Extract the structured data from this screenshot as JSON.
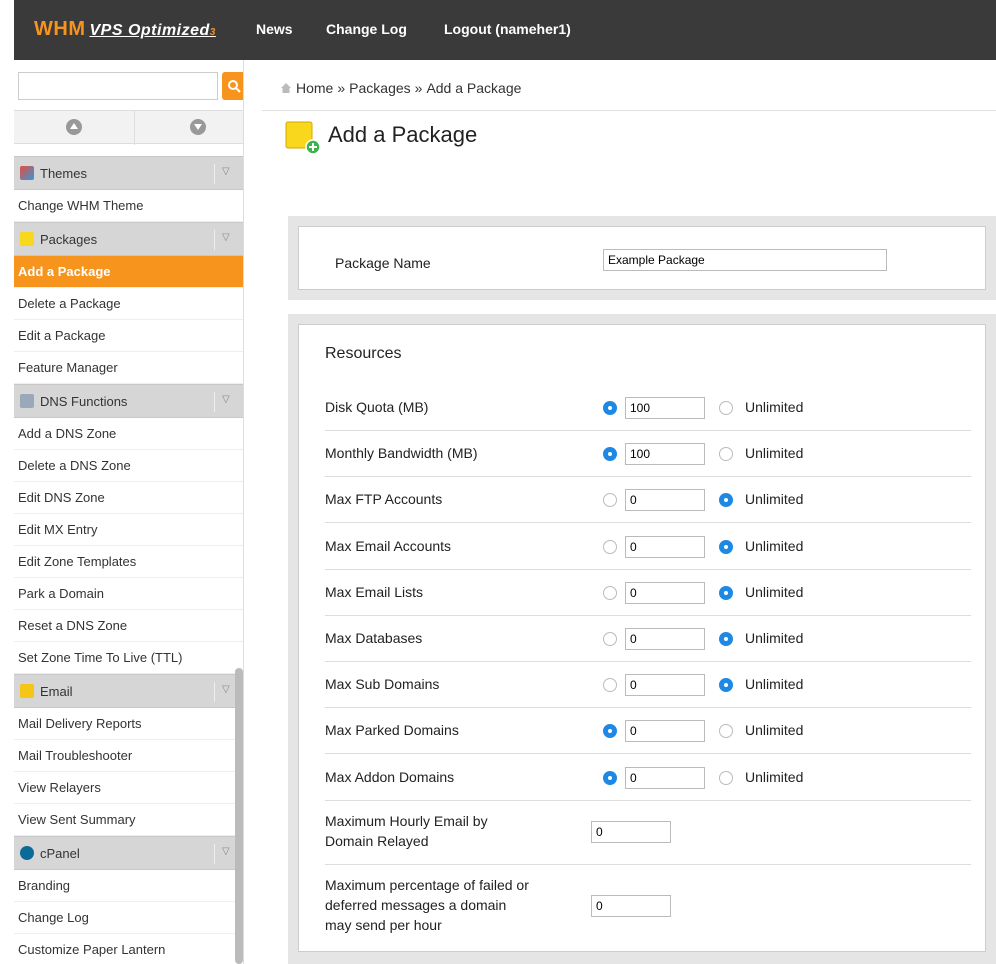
{
  "header": {
    "logo_main": "WHM",
    "logo_sub": "VPS Optimized",
    "logo_sub_num": "3",
    "nav": [
      "News",
      "Change Log",
      "Logout (nameher1)"
    ]
  },
  "sidebar": {
    "search_placeholder": "",
    "groups": [
      {
        "label": "Themes",
        "icon": "themes-icon",
        "items": [
          "Change WHM Theme"
        ]
      },
      {
        "label": "Packages",
        "icon": "packages-icon",
        "items": [
          "Add a Package",
          "Delete a Package",
          "Edit a Package",
          "Feature Manager"
        ]
      },
      {
        "label": "DNS Functions",
        "icon": "dns-icon",
        "items": [
          "Add a DNS Zone",
          "Delete a DNS Zone",
          "Edit DNS Zone",
          "Edit MX Entry",
          "Edit Zone Templates",
          "Park a Domain",
          "Reset a DNS Zone",
          "Set Zone Time To Live (TTL)"
        ]
      },
      {
        "label": "Email",
        "icon": "email-icon",
        "items": [
          "Mail Delivery Reports",
          "Mail Troubleshooter",
          "View Relayers",
          "View Sent Summary"
        ]
      },
      {
        "label": "cPanel",
        "icon": "cpanel-icon",
        "items": [
          "Branding",
          "Change Log",
          "Customize Paper Lantern"
        ]
      }
    ],
    "active_item": "Add a Package"
  },
  "breadcrumb": [
    "Home",
    "Packages",
    "Add a Package"
  ],
  "page_title": "Add a Package",
  "package_name": {
    "label": "Package Name",
    "value": "Example Package"
  },
  "resources": {
    "title": "Resources",
    "unlimited_label": "Unlimited",
    "rows": [
      {
        "label": "Disk Quota (MB)",
        "value": "100",
        "limited": true
      },
      {
        "label": "Monthly Bandwidth (MB)",
        "value": "100",
        "limited": true
      },
      {
        "label": "Max FTP Accounts",
        "value": "0",
        "limited": false
      },
      {
        "label": "Max Email Accounts",
        "value": "0",
        "limited": false
      },
      {
        "label": "Max Email Lists",
        "value": "0",
        "limited": false
      },
      {
        "label": "Max Databases",
        "value": "0",
        "limited": false
      },
      {
        "label": "Max Sub Domains",
        "value": "0",
        "limited": false
      },
      {
        "label": "Max Parked Domains",
        "value": "0",
        "limited": true
      },
      {
        "label": "Max Addon Domains",
        "value": "0",
        "limited": true
      }
    ],
    "hourly_email": {
      "label_line1": "Maximum Hourly Email by",
      "label_line2": "Domain Relayed",
      "value": "0"
    },
    "failed_pct": {
      "label_line1": "Maximum percentage of failed or",
      "label_line2": "deferred messages a domain",
      "label_line3": "may send per hour",
      "value": "0"
    }
  },
  "colors": {
    "accent": "#f7941d",
    "topbar": "#3a3a3a",
    "radio_on": "#1e88e5"
  }
}
